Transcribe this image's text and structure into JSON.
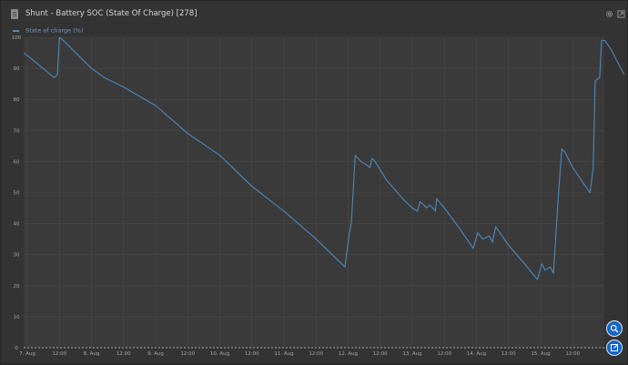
{
  "panel": {
    "title": "Shunt - Battery SOC (State Of Charge) [278]"
  },
  "icons": {
    "document": "document-icon",
    "settings": "gear-icon",
    "expand": "expand-icon",
    "zoom_fab": "zoom-in-icon",
    "export_fab": "export-icon"
  },
  "colors": {
    "series": "#4e89ba",
    "background": "#333333",
    "plot_background": "#3a3a3a",
    "grid": "#4a4a4a",
    "fab": "#1565c0"
  },
  "chart_data": {
    "type": "line",
    "title": "Shunt - Battery SOC (State Of Charge) [278]",
    "xlabel": "",
    "ylabel": "",
    "ylim": [
      0,
      100
    ],
    "yticks": [
      0,
      10,
      20,
      30,
      40,
      50,
      60,
      70,
      80,
      90,
      100
    ],
    "xlim": [
      0,
      8.75
    ],
    "x_unit": "days since 7 Aug 00:00",
    "xticks": [
      {
        "x": 0,
        "label": "7. Aug"
      },
      {
        "x": 0.5,
        "label": "12:00"
      },
      {
        "x": 1,
        "label": "8. Aug"
      },
      {
        "x": 1.5,
        "label": "12:00"
      },
      {
        "x": 2,
        "label": "9. Aug"
      },
      {
        "x": 2.5,
        "label": "12:00"
      },
      {
        "x": 3,
        "label": "10. Aug"
      },
      {
        "x": 3.5,
        "label": "12:00"
      },
      {
        "x": 4,
        "label": "11. Aug"
      },
      {
        "x": 4.5,
        "label": "12:00"
      },
      {
        "x": 5,
        "label": "12. Aug"
      },
      {
        "x": 5.5,
        "label": "12:00"
      },
      {
        "x": 6,
        "label": "13. Aug"
      },
      {
        "x": 6.5,
        "label": "12:00"
      },
      {
        "x": 7,
        "label": "14. Aug"
      },
      {
        "x": 7.5,
        "label": "12:00"
      },
      {
        "x": 8,
        "label": "15. Aug"
      },
      {
        "x": 8.5,
        "label": "12:00"
      }
    ],
    "grid": true,
    "legend_position": "top-left",
    "series": [
      {
        "name": "State of charge (%)",
        "points": [
          [
            -0.05,
            95
          ],
          [
            0.42,
            87
          ],
          [
            0.47,
            88
          ],
          [
            0.5,
            100
          ],
          [
            0.56,
            99
          ],
          [
            1.0,
            90
          ],
          [
            1.2,
            87
          ],
          [
            1.5,
            84
          ],
          [
            2.0,
            78
          ],
          [
            2.5,
            69
          ],
          [
            3.0,
            62
          ],
          [
            3.5,
            52
          ],
          [
            4.0,
            44
          ],
          [
            4.5,
            35
          ],
          [
            4.95,
            26
          ],
          [
            5.02,
            37
          ],
          [
            5.05,
            40
          ],
          [
            5.11,
            62
          ],
          [
            5.2,
            60
          ],
          [
            5.28,
            59
          ],
          [
            5.34,
            58
          ],
          [
            5.37,
            61
          ],
          [
            5.42,
            60
          ],
          [
            5.6,
            54
          ],
          [
            5.85,
            48
          ],
          [
            6.0,
            45
          ],
          [
            6.08,
            44
          ],
          [
            6.12,
            47
          ],
          [
            6.18,
            46
          ],
          [
            6.22,
            45
          ],
          [
            6.27,
            46
          ],
          [
            6.32,
            45
          ],
          [
            6.36,
            44
          ],
          [
            6.38,
            48
          ],
          [
            6.5,
            45
          ],
          [
            6.75,
            38
          ],
          [
            6.95,
            32
          ],
          [
            7.02,
            37
          ],
          [
            7.1,
            35
          ],
          [
            7.2,
            36
          ],
          [
            7.25,
            34
          ],
          [
            7.3,
            39
          ],
          [
            7.5,
            33
          ],
          [
            7.75,
            27
          ],
          [
            7.95,
            22
          ],
          [
            8.02,
            27
          ],
          [
            8.07,
            25
          ],
          [
            8.15,
            26
          ],
          [
            8.2,
            24
          ],
          [
            8.28,
            50
          ],
          [
            8.33,
            64
          ],
          [
            8.38,
            63
          ],
          [
            8.5,
            58
          ],
          [
            8.7,
            52
          ],
          [
            8.77,
            50
          ],
          [
            8.82,
            58
          ],
          [
            8.85,
            86
          ],
          [
            8.92,
            87
          ],
          [
            8.95,
            99
          ],
          [
            9.0,
            99
          ],
          [
            9.1,
            96
          ],
          [
            9.3,
            88
          ]
        ]
      }
    ]
  }
}
